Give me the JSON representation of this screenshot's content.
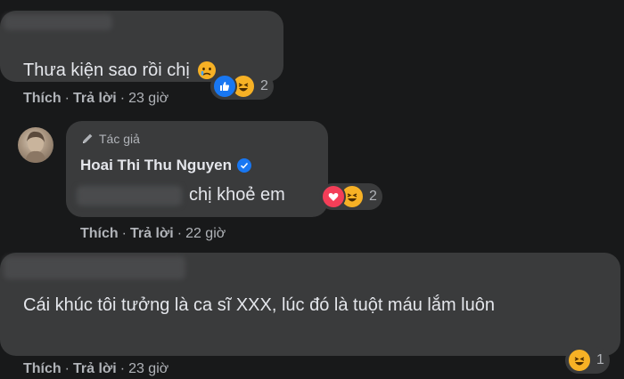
{
  "comments": [
    {
      "text": "Thưa kiện sao rồi chị",
      "emoji": "teary-face",
      "actions": {
        "like": "Thích",
        "reply": "Trả lời",
        "time": "23 giờ"
      },
      "reactions": {
        "types": [
          "like",
          "haha"
        ],
        "count": "2"
      }
    },
    {
      "author_badge": "Tác giả",
      "author_name": "Hoai Thi Thu Nguyen",
      "verified": true,
      "text": "chị khoẻ em",
      "actions": {
        "like": "Thích",
        "reply": "Trả lời",
        "time": "22 giờ"
      },
      "reactions": {
        "types": [
          "love",
          "haha"
        ],
        "count": "2"
      }
    },
    {
      "text": "Cái khúc tôi tưởng là ca sĩ XXX, lúc đó là tuột máu lắm luôn",
      "actions": {
        "like": "Thích",
        "reply": "Trả lời",
        "time": "23 giờ"
      },
      "reactions": {
        "types": [
          "haha"
        ],
        "count": "1"
      }
    }
  ],
  "separator": "·",
  "colors": {
    "background": "#18191a",
    "bubble": "#3a3b3c",
    "text": "#e4e6eb",
    "secondary_text": "#b0b3b8",
    "like_blue": "#1877f2",
    "love_red": "#f33e58",
    "haha_yellow": "#f7b125"
  }
}
